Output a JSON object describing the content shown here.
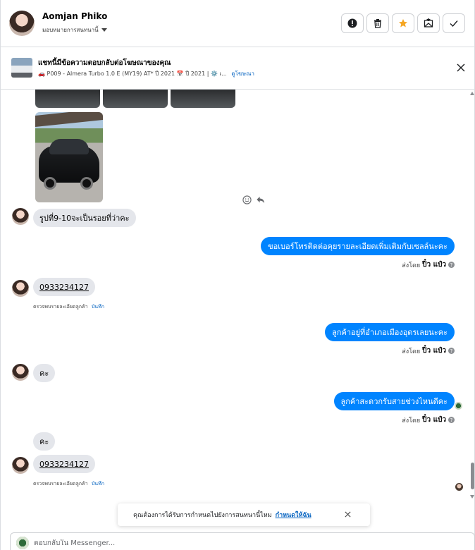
{
  "header": {
    "name": "Aomjan Phiko",
    "assign_label": "มอบหมายการสนทนานี้",
    "actions": [
      {
        "name": "report-icon",
        "label": "!"
      },
      {
        "name": "trash-icon",
        "label": ""
      },
      {
        "name": "star-icon",
        "label": ""
      },
      {
        "name": "mark-unread-icon",
        "label": ""
      },
      {
        "name": "check-icon",
        "label": ""
      }
    ],
    "star_color": "#f5a623"
  },
  "ad": {
    "title": "แชทนี้มีข้อความตอบกลับต่อโฆษณาของคุณ",
    "subtitle": "🚗 P009 - Almera Turbo 1.0 E (MY19) AT* ปี 2021 📅 ปี 2021 | ⚙️ เ...",
    "view_ad": "ดูโฆษณา"
  },
  "messages": {
    "m1": "รูปที่9-10จะเป็นรอยที่ว่าคะ",
    "m2": "ขอเบอร์โทรติดต่อคุยรายละเอียดเพิ่มเติมกับเซลล์นะคะ",
    "m3": "0933234127",
    "m4": "ลูกค้าอยู่ที่อำเภอเมืองอุดรเลยนะคะ",
    "m5": "คะ",
    "m6": "ลูกค้าสะดวกรับสายช่วงไหนดีคะ",
    "m7": "คะ",
    "m8": "0933234127"
  },
  "sent_by": {
    "prefix": "ส่งโดย",
    "agent": "ปิ๋ว แป๋ว",
    "help": "?"
  },
  "detect": {
    "text": "ตรวจพบรายละเอียดลูกค้า",
    "save": "บันทึก"
  },
  "toast": {
    "text": "คุณต้องการได้รับการกำหนดไปยังการสนทนานี้ไหม",
    "link": "กำหนดให้ฉัน"
  },
  "composer": {
    "placeholder": "ตอบกลับใน Messenger..."
  },
  "colors": {
    "outgoing_bubble": "#0084ff",
    "incoming_bubble": "#e4e6eb",
    "link": "#0a66c2"
  }
}
